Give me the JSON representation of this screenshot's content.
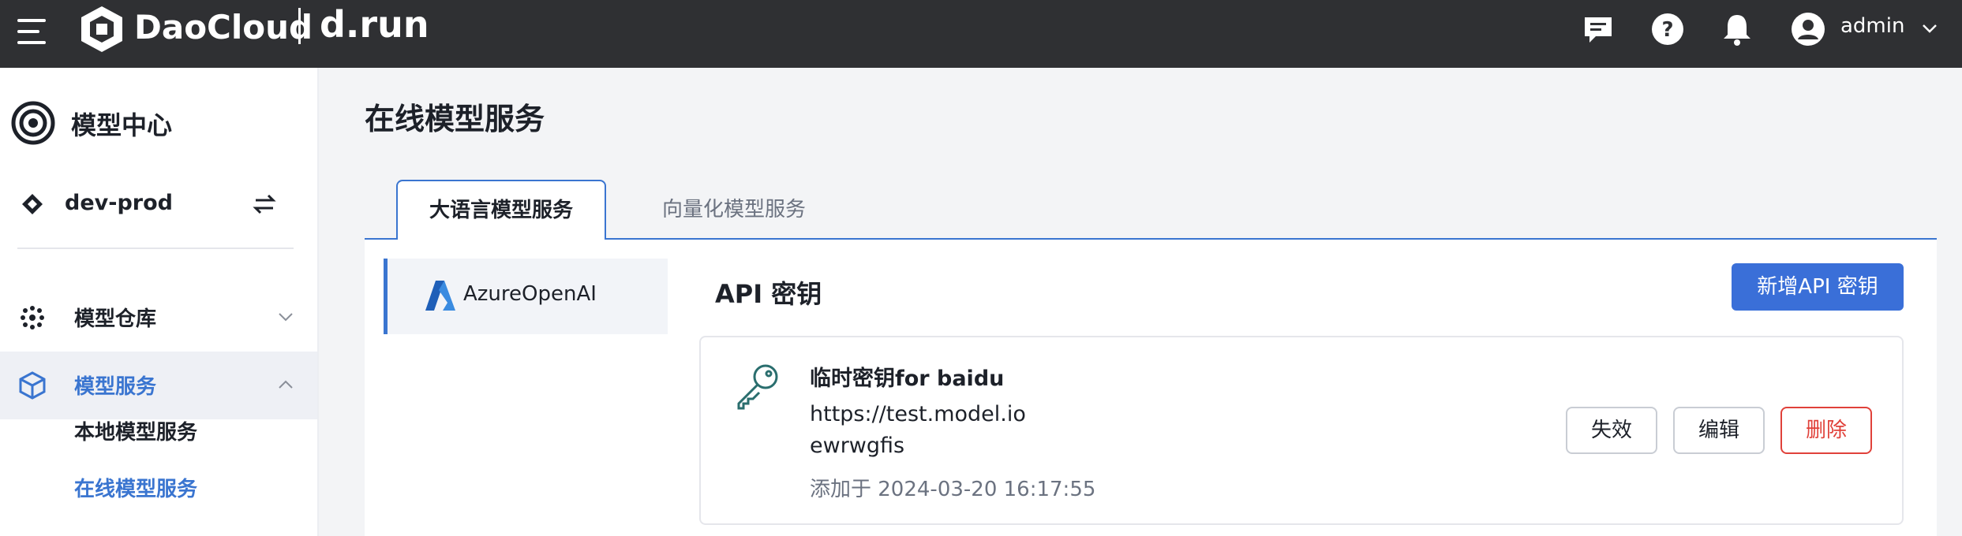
{
  "topbar": {
    "brand": "DaoCloud",
    "product": "d.run",
    "user": "admin",
    "icons": [
      "menu-icon",
      "chat-icon",
      "help-icon",
      "bell-icon",
      "user-avatar-icon",
      "chevron-down-icon"
    ]
  },
  "sidebar": {
    "title": "模型中心",
    "workspace": "dev-prod",
    "items": [
      {
        "label": "模型仓库",
        "icon": "model-repo-icon",
        "expanded": false
      },
      {
        "label": "模型服务",
        "icon": "cube-icon",
        "expanded": true,
        "active": true
      }
    ],
    "subitems": [
      {
        "label": "本地模型服务",
        "active": false
      },
      {
        "label": "在线模型服务",
        "active": true
      }
    ]
  },
  "main": {
    "page_title": "在线模型服务",
    "tabs": [
      {
        "label": "大语言模型服务",
        "active": true
      },
      {
        "label": "向量化模型服务",
        "active": false
      }
    ],
    "provider": "AzureOpenAI",
    "section_title": "API 密钥",
    "add_button": "新增API 密钥",
    "key": {
      "name": "临时密钥for baidu",
      "url": "https://test.model.io",
      "secret": "ewrwgfis",
      "added": "添加于 2024-03-20 16:17:55",
      "actions": {
        "disable": "失效",
        "edit": "编辑",
        "delete": "删除"
      }
    }
  },
  "colors": {
    "accent": "#3a75d0",
    "topbar": "#2f3033",
    "danger": "#e0413a",
    "muted": "#6b7280"
  }
}
